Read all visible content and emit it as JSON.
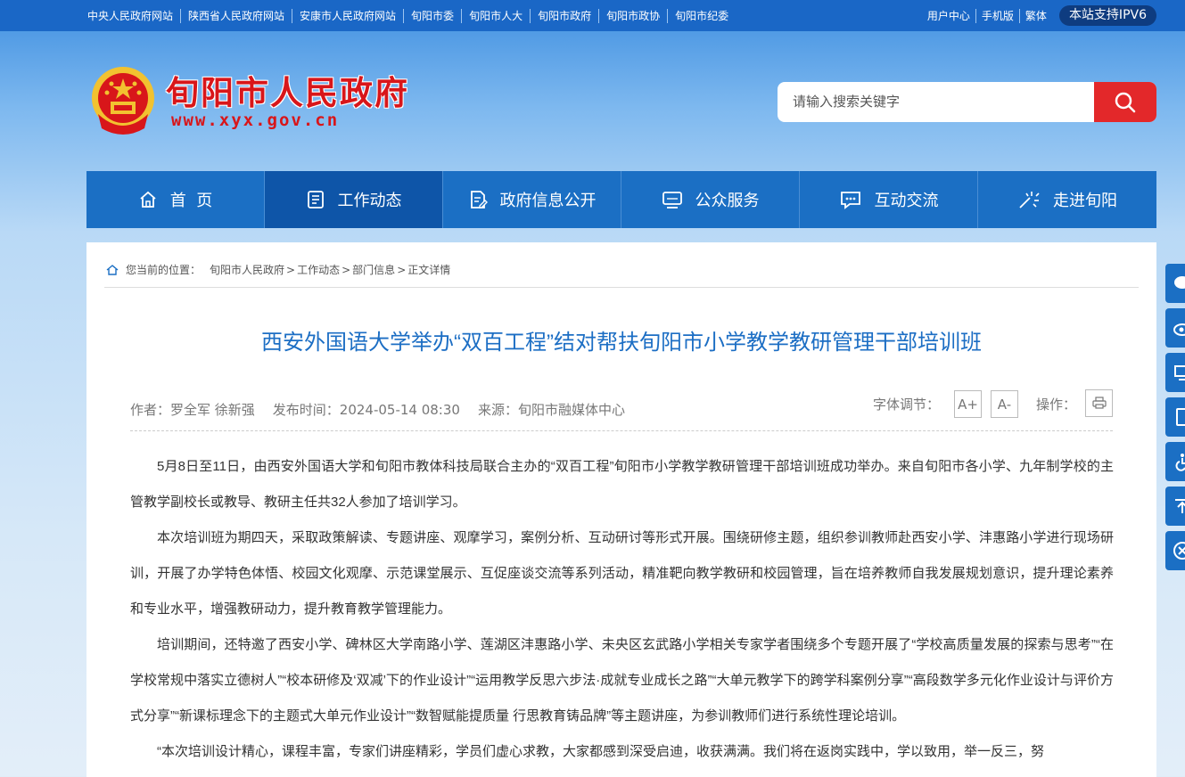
{
  "top_links": [
    "中央人民政府网站",
    "陕西省人民政府网站",
    "安康市人民政府网站",
    "旬阳市委",
    "旬阳市人大",
    "旬阳市政府",
    "旬阳市政协",
    "旬阳市纪委"
  ],
  "top_right": {
    "user_center": "用户中心",
    "mobile": "手机版",
    "traditional": "繁体",
    "ipv6": "本站支持IPV6"
  },
  "header": {
    "site_name": "旬阳市人民政府",
    "site_url": "www.xyx.gov.cn"
  },
  "search": {
    "placeholder": "请输入搜索关键字"
  },
  "nav": [
    {
      "label": "首  页",
      "icon": "home-icon"
    },
    {
      "label": "工作动态",
      "icon": "document-list-icon"
    },
    {
      "label": "政府信息公开",
      "icon": "file-edit-icon"
    },
    {
      "label": "公众服务",
      "icon": "monitor-icon"
    },
    {
      "label": "互动交流",
      "icon": "chat-bubble-icon"
    },
    {
      "label": "走进旬阳",
      "icon": "sparkle-icon"
    }
  ],
  "breadcrumb": {
    "prefix": "您当前的位置：",
    "items": [
      "旬阳市人民政府",
      "工作动态",
      "部门信息",
      "正文详情"
    ]
  },
  "article": {
    "title": "西安外国语大学举办“双百工程”结对帮扶旬阳市小学教学教研管理干部培训班",
    "author": "作者：罗全军 徐新强",
    "date": "发布时间：2024-05-14 08:30",
    "source": "来源：旬阳市融媒体中心",
    "font_adjust_label": "字体调节：",
    "font_increase": "A+",
    "font_decrease": "A-",
    "operation_label": "操作：",
    "paragraphs": [
      "5月8日至11日，由西安外国语大学和旬阳市教体科技局联合主办的“双百工程”旬阳市小学教学教研管理干部培训班成功举办。来自旬阳市各小学、九年制学校的主管教学副校长或教导、教研主任共32人参加了培训学习。",
      "本次培训班为期四天，采取政策解读、专题讲座、观摩学习，案例分析、互动研讨等形式开展。围绕研修主题，组织参训教师赴西安小学、沣惠路小学进行现场研训，开展了办学特色体悟、校园文化观摩、示范课堂展示、互促座谈交流等系列活动，精准靶向教学教研和校园管理，旨在培养教师自我发展规划意识，提升理论素养和专业水平，增强教研动力，提升教育教学管理能力。",
      "培训期间，还特邀了西安小学、碑林区大学南路小学、莲湖区沣惠路小学、未央区玄武路小学相关专家学者围绕多个专题开展了“学校高质量发展的探索与思考”“在学校常规中落实立德树人”“校本研修及‘双减’下的作业设计”“运用教学反思六步法·成就专业成长之路”“大单元教学下的跨学科案例分享”“高段数学多元化作业设计与评价方式分享”“新课标理念下的主题式大单元作业设计”“数智赋能提质量  行思教育铸品牌”等主题讲座，为参训教师们进行系统性理论培训。",
      "“本次培训设计精心，课程丰富，专家们讲座精彩，学员们虚心求教，大家都感到深受启迪，收获满满。我们将在返岗实践中，学以致用，举一反三，努"
    ]
  },
  "colors": {
    "primary": "#1b6fc4",
    "active_nav": "#0e55a8",
    "brand_red": "#d8161a",
    "search_red": "#e3282a",
    "title_blue": "#1c6ec4"
  },
  "side_buttons": [
    "wechat-icon",
    "weibo-icon",
    "monitor-icon",
    "mobile-icon",
    "accessibility-icon",
    "back-to-top-icon",
    "close-icon"
  ]
}
